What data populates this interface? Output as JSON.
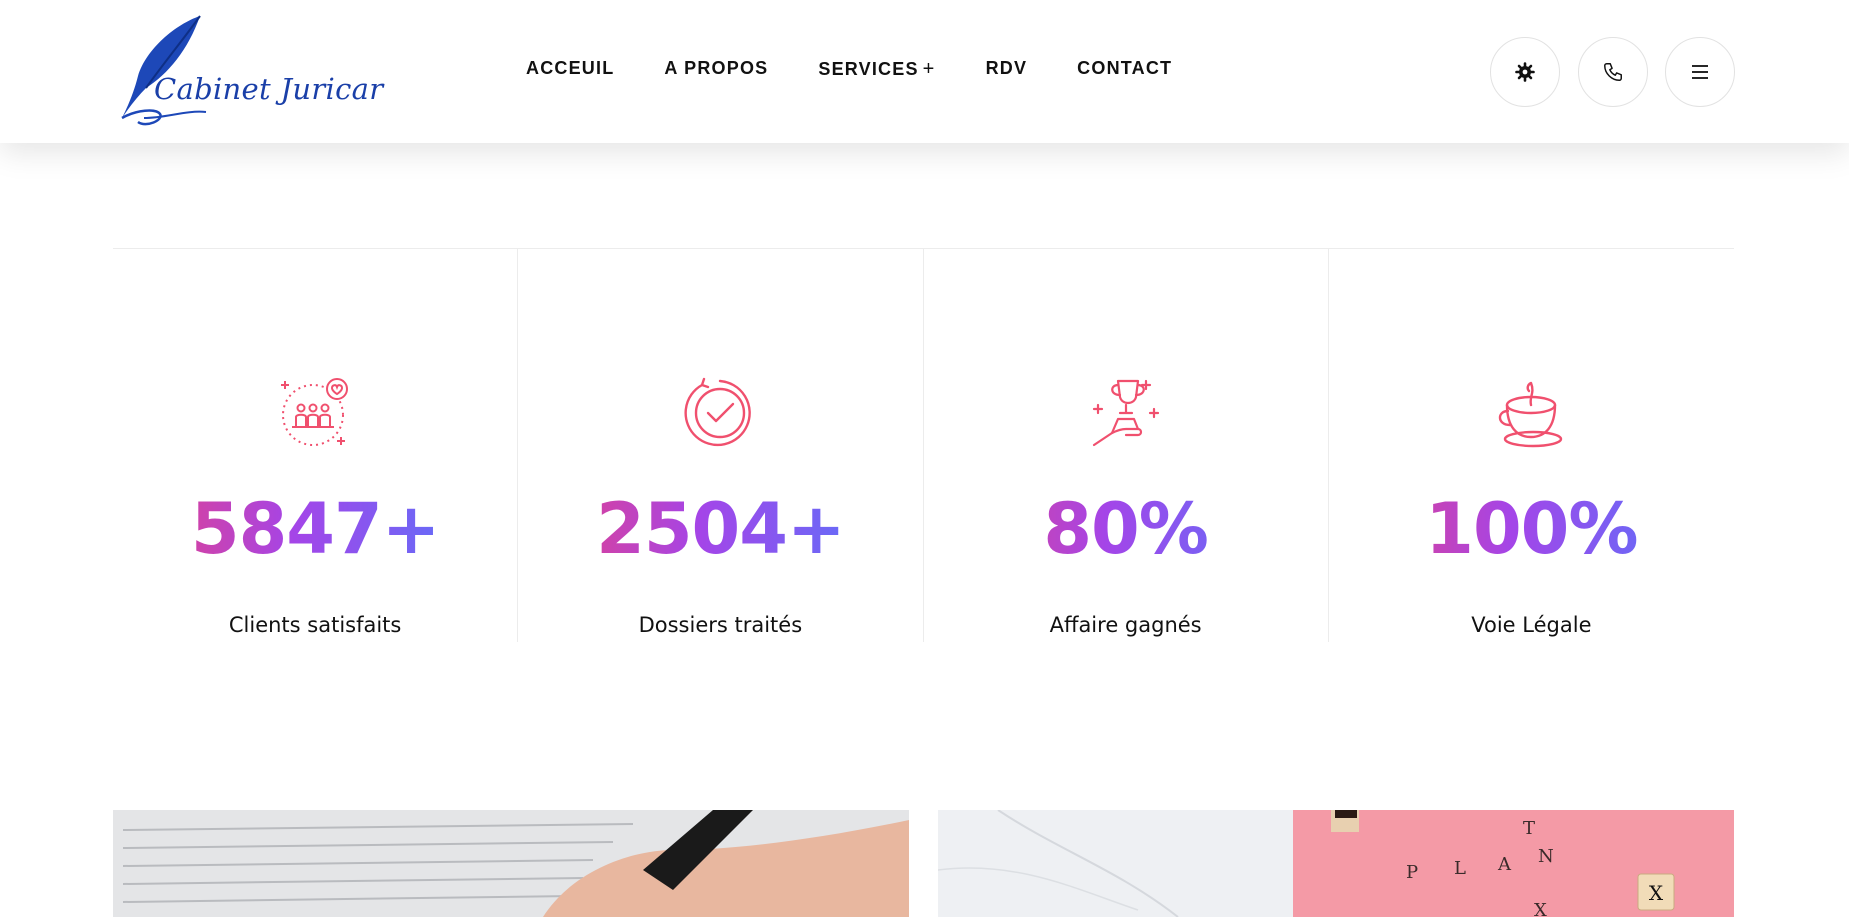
{
  "brand": {
    "logo_text": "Cabinet Juricar",
    "color": "#1a3fa8"
  },
  "nav": {
    "items": [
      {
        "label": "ACCEUIL"
      },
      {
        "label": "A PROPOS"
      },
      {
        "label": "SERVICES",
        "suffix": "+"
      },
      {
        "label": "RDV"
      },
      {
        "label": "CONTACT"
      }
    ]
  },
  "header_buttons": [
    {
      "icon": "gear-icon"
    },
    {
      "icon": "phone-icon"
    },
    {
      "icon": "menu-icon"
    }
  ],
  "stats": [
    {
      "icon": "team-heart-icon",
      "value": "5847+",
      "label": "Clients satisfaits"
    },
    {
      "icon": "check-circle-icon",
      "value": "2504+",
      "label": "Dossiers traités"
    },
    {
      "icon": "trophy-hand-icon",
      "value": "80%",
      "label": "Affaire gagnés"
    },
    {
      "icon": "coffee-cup-icon",
      "value": "100%",
      "label": "Voie Légale"
    }
  ],
  "colors": {
    "accent_pink": "#f0407a",
    "accent_purple": "#a445e8",
    "accent_blue": "#4a7dff",
    "icon_color": "#f0506e"
  },
  "photos": {
    "right_tiles": [
      "T",
      "P",
      "L",
      "A",
      "N",
      "X",
      "X"
    ]
  }
}
